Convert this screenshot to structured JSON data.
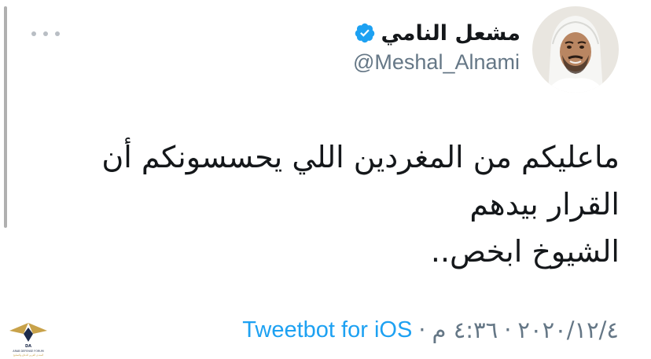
{
  "author": {
    "display_name": "مشعل النامي",
    "handle": "@Meshal_Alnami",
    "verified": true
  },
  "tweet": {
    "lines": [
      "ماعليكم من المغردين اللي يحسسونكم أن",
      "القرار بيدهم",
      "الشيوخ ابخص.."
    ]
  },
  "meta": {
    "date": "٢٠٢٠/١٢/٤",
    "separator": "·",
    "time": "٤:٣٦ م",
    "via": "Tweetbot for iOS"
  },
  "watermark": {
    "text": "ARAB DEFENSE FORUM",
    "subtext": "المنتدى العربي للدفاع والتسليح"
  },
  "colors": {
    "text": "#14171a",
    "secondary": "#657786",
    "link": "#1da1f2",
    "verified": "#1da1f2"
  },
  "icons": {
    "more": "more-dots-icon",
    "verified": "verified-badge-icon"
  }
}
